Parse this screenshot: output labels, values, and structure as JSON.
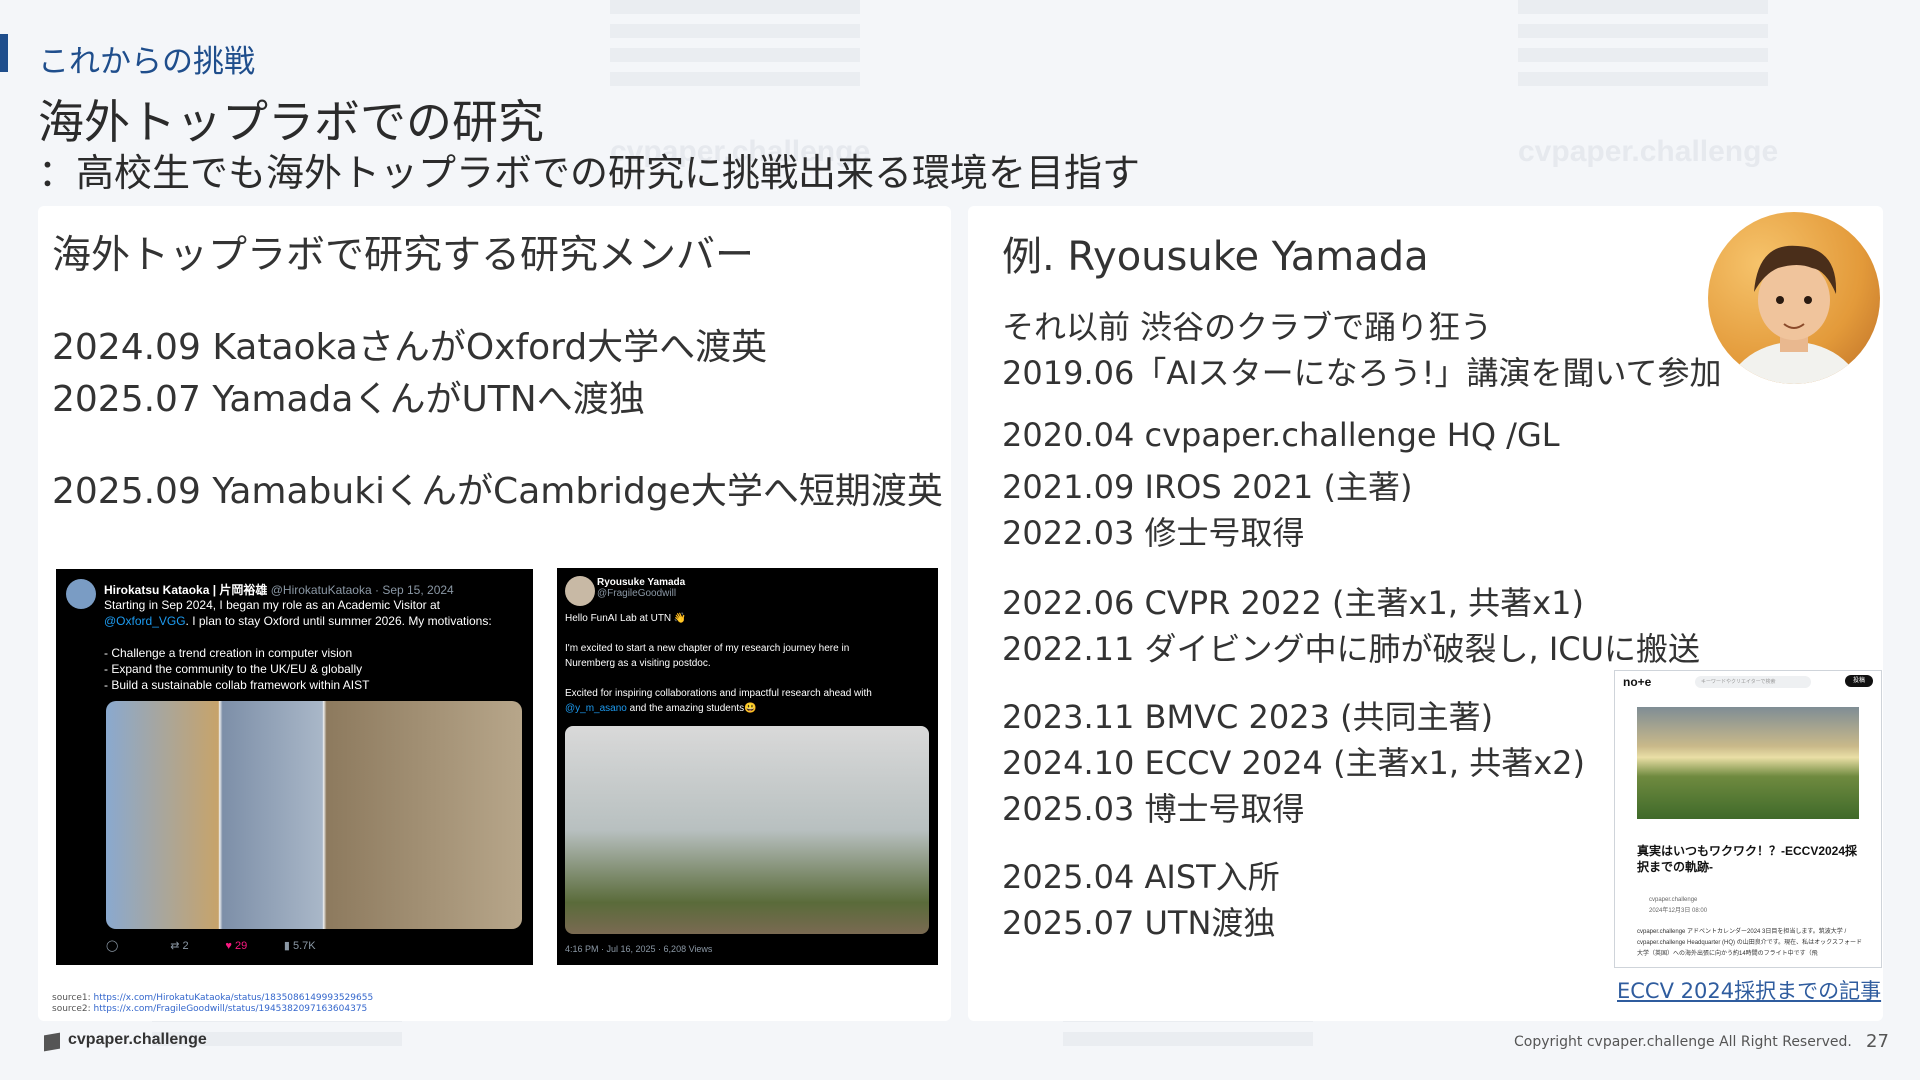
{
  "header": {
    "section": "これからの挑戦",
    "title": "海外トップラボでの研究",
    "subtitle": "：高校生でも海外トップラボでの研究に挑戦出来る環境を目指す"
  },
  "watermark": "cvpaper.challenge",
  "left_panel": {
    "heading": "海外トップラボで研究する研究メンバー",
    "lines": [
      "2024.09 KataokaさんがOxford大学へ渡英",
      "2025.07 YamadaくんがUTNへ渡独",
      "2025.09 YamabukiくんがCambridge大学へ短期渡英"
    ],
    "tweet1": {
      "name": "Hirokatsu Kataoka | 片岡裕雄",
      "handle": "@HirokatuKataoka · Sep 15, 2024",
      "line1": "Starting in Sep 2024, I began my role as an Academic Visitor at",
      "link": "@Oxford_VGG",
      "line2": ". I plan to stay Oxford until summer 2026. My motivations:",
      "bullets": "- Challenge a trend creation in computer vision\n- Expand the community to the UK/EU & globally\n- Build a sustainable collab framework within AIST",
      "reposts": "2",
      "likes": "29",
      "views": "5.7K"
    },
    "tweet2": {
      "name": "Ryousuke Yamada",
      "handle": "@FragileGoodwill",
      "line1": "Hello FunAI Lab at UTN 👋",
      "line2": "I'm excited to start a new chapter of my research journey here in\nNuremberg as a visiting postdoc.",
      "line3": "Excited for inspiring collaborations and impactful research ahead with",
      "link": "@y_m_asano",
      "line4": " and the amazing students😃",
      "footer": "4:16 PM · Jul 16, 2025 · 6,208 Views"
    },
    "source1_label": "source1: ",
    "source1": "https://x.com/HirokatuKataoka/status/1835086149993529655",
    "source2_label": "source2: ",
    "source2": "https://x.com/FragileGoodwill/status/1945382097163604375"
  },
  "right_panel": {
    "heading": "例. Ryousuke Yamada",
    "groups": [
      [
        "それ以前 渋谷のクラブで踊り狂う",
        "2019.06「AIスターになろう!」講演を聞いて参加"
      ],
      [
        "2020.04 cvpaper.challenge HQ /GL",
        "2021.09 IROS 2021 (主著)",
        "2022.03 修士号取得"
      ],
      [
        "2022.06 CVPR 2022 (主著x1, 共著x1)",
        "2022.11 ダイビング中に肺が破裂し, ICUに搬送"
      ],
      [
        "2023.11 BMVC 2023 (共同主著)",
        "2024.10 ECCV 2024 (主著x1, 共著x2)",
        "2025.03 博士号取得"
      ],
      [
        "2025.04 AIST入所",
        "2025.07 UTN渡独"
      ]
    ],
    "note": {
      "logo": "no+e",
      "search": "キーワードやクリエイターで検索",
      "button": "投稿",
      "title": "真実はいつもワクワク！？-ECCV2024採択までの軌跡-",
      "author": "cvpaper.challenge",
      "date": "2024年12月3日 08:00",
      "body": "cvpaper.challenge アドベントカレンダー2024 3日目を担当します。筑波大学 / cvpaper.challenge Headquarter (HQ) の山田良介です。現在、私はオックスフォード大学（英国）への海外出張に向かう約14時間のフライト中です（飛"
    },
    "caption": "ECCV 2024採択までの記事"
  },
  "footer": {
    "logo": "cvpaper.challenge",
    "copyright": "Copyright cvpaper.challenge All Right Reserved.",
    "page": "27"
  }
}
